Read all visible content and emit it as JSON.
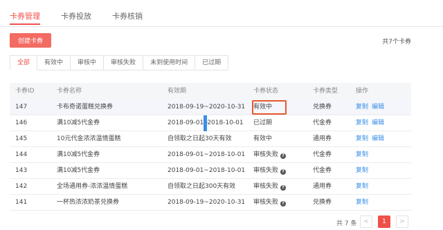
{
  "top_tabs": [
    "卡券管理",
    "卡券投放",
    "卡券核销"
  ],
  "create_button": "创建卡券",
  "total_right": "共7个卡券",
  "filters": [
    "全部",
    "有效中",
    "审核中",
    "审核失败",
    "未到使用时间",
    "已过期"
  ],
  "table": {
    "headers": [
      "卡券ID",
      "卡券名称",
      "有效期",
      "卡券状态",
      "卡券类型",
      "操作"
    ],
    "rows": [
      {
        "id": "147",
        "name": "卡布奇诺蛋糕兑换券",
        "period": "2018-09-19~2020-10-31",
        "status": "有效中",
        "type": "兑换券",
        "ops": [
          "复制",
          "编辑"
        ]
      },
      {
        "id": "146",
        "name": "满10减5代金券",
        "period_a": "2018-09-01",
        "period_b": "2018-10-01",
        "status": "已过期",
        "type": "代金券",
        "ops": [
          "复制",
          "编辑"
        ]
      },
      {
        "id": "145",
        "name": "10元代金浓浓温情蛋糕",
        "period": "自领取之日起30天有效",
        "status": "有效中",
        "type": "通用券",
        "ops": [
          "复制",
          "编辑"
        ]
      },
      {
        "id": "144",
        "name": "满10减5代金券",
        "period": "2018-09-01~2018-10-01",
        "status": "审核失败",
        "type": "代金券",
        "ops": [
          "复制"
        ]
      },
      {
        "id": "143",
        "name": "满10减5代金券",
        "period": "2018-09-01~2018-10-01",
        "status": "审核失败",
        "type": "代金券",
        "ops": [
          "复制"
        ]
      },
      {
        "id": "142",
        "name": "全场通用券-浓浓温情蛋糕",
        "period": "自领取之日起300天有效",
        "status": "审核失败",
        "type": "通用券",
        "ops": [
          "复制"
        ]
      },
      {
        "id": "141",
        "name": "一杯热浓浓奶茶兑换券",
        "period": "2018-09-19~2020-10-31",
        "status": "审核失败",
        "type": "兑换券",
        "ops": [
          "复制"
        ]
      }
    ]
  },
  "pagination": {
    "total": "共 7 条",
    "prev": "<",
    "current": "1",
    "next": ">"
  },
  "colors": {
    "accent": "#f0504a",
    "link": "#3a8ee6"
  }
}
